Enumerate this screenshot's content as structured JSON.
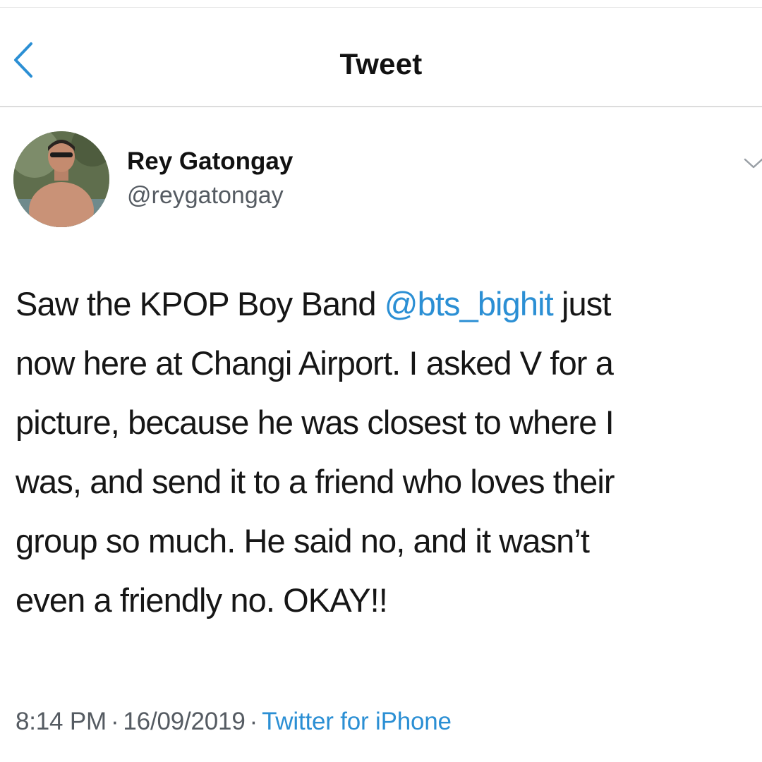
{
  "header": {
    "title": "Tweet",
    "back_icon": "chevron-left-icon"
  },
  "author": {
    "name": "Rey Gatongay",
    "handle": "@reygatongay",
    "avatar_icon": "avatar-photo"
  },
  "more_icon": "chevron-down-icon",
  "tweet": {
    "lines": [
      [
        "Saw the KPOP Boy Band ",
        "@bts_bighit",
        " just"
      ],
      "now here at Changi Airport. I asked V for a",
      "picture, because he was closest to where I",
      "was, and send it to a friend who loves their",
      "group so much. He said no, and it wasn’t",
      "even a friendly no. OKAY!!"
    ],
    "time": "8:14 PM",
    "separator": "·",
    "date": "16/09/2019",
    "source": "Twitter for iPhone"
  },
  "colors": {
    "link": "#2b8fd4",
    "secondary_text": "#555b62",
    "divider": "#dcdcdc"
  }
}
